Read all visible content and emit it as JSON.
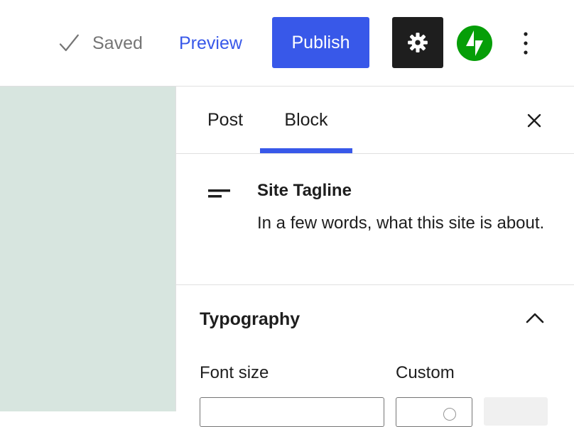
{
  "header": {
    "saved_label": "Saved",
    "preview_label": "Preview",
    "publish_label": "Publish",
    "icons": {
      "saved": "check-icon",
      "settings": "gear-icon",
      "jetpack": "jetpack-bolt-icon",
      "more": "more-vertical-icon"
    }
  },
  "sidebar": {
    "tabs": [
      {
        "label": "Post",
        "active": false
      },
      {
        "label": "Block",
        "active": true
      }
    ],
    "block": {
      "icon": "site-tagline-icon",
      "title": "Site Tagline",
      "description": "In a few words, what this site is about."
    },
    "typography": {
      "title": "Typography",
      "expanded": true,
      "font_size_label": "Font size",
      "custom_label": "Custom"
    }
  },
  "colors": {
    "accent": "#3858e9",
    "settings_bg": "#1e1e1e",
    "jetpack_green": "#069e08",
    "canvas_bg": "#d7e5df",
    "muted_text": "#757575"
  }
}
